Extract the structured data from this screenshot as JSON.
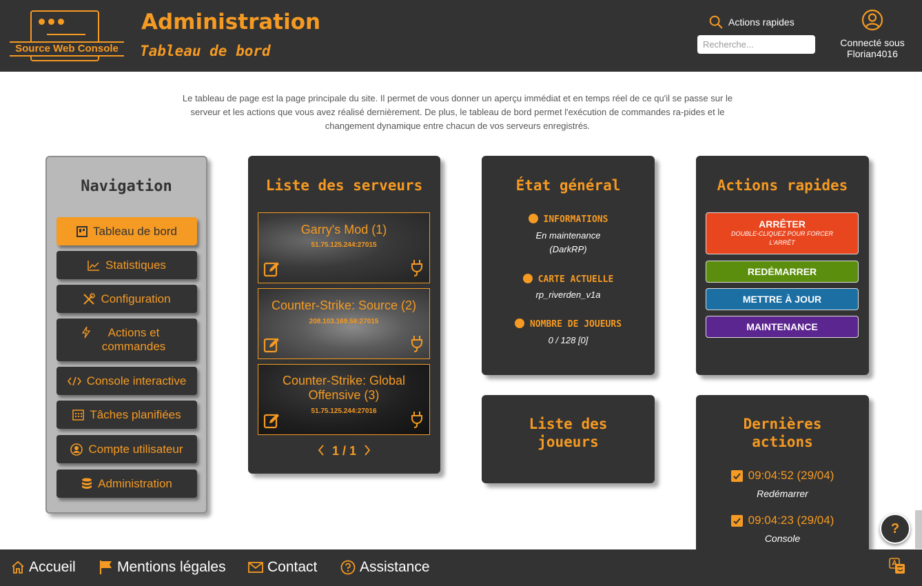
{
  "header": {
    "logo_text": "Source Web Console",
    "title": "Administration",
    "subtitle": "Tableau de bord",
    "quick_actions_label": "Actions rapides",
    "search_placeholder": "Recherche...",
    "user_line1": "Connecté sous",
    "user_line2": "Florian4016"
  },
  "intro": "Le tableau de page est la page principale du site. Il permet de vous donner un aperçu immédiat et en temps réel de ce qu'il se passe sur le serveur et les actions que vous avez réalisé dernièrement. De plus, le tableau de bord permet l'exécution de commandes ra-pides et le changement dynamique entre chacun de vos serveurs enregistrés.",
  "navigation": {
    "title": "Navigation",
    "items": [
      {
        "label": "Tableau de bord",
        "icon": "dashboard-icon",
        "active": true
      },
      {
        "label": "Statistiques",
        "icon": "chart-icon"
      },
      {
        "label": "Configuration",
        "icon": "tools-icon"
      },
      {
        "label": "Actions et commandes",
        "icon": "bolt-icon"
      },
      {
        "label": "Console interactive",
        "icon": "code-icon"
      },
      {
        "label": "Tâches planifiées",
        "icon": "calendar-icon"
      },
      {
        "label": "Compte utilisateur",
        "icon": "user-circle-icon"
      },
      {
        "label": "Administration",
        "icon": "database-icon"
      }
    ]
  },
  "servers": {
    "title": "Liste des serveurs",
    "items": [
      {
        "name": "Garry's Mod (1)",
        "address": "51.75.125.244:27015"
      },
      {
        "name": "Counter-Strike: Source (2)",
        "address": "208.103.169.58:27015"
      },
      {
        "name": "Counter-Strike: Global Offensive (3)",
        "address": "51.75.125.244:27016"
      }
    ],
    "page": "1 / 1"
  },
  "status": {
    "title": "État général",
    "info_label": "INFORMATIONS",
    "info_value_1": "En maintenance",
    "info_value_2": "(DarkRP)",
    "map_label": "CARTE ACTUELLE",
    "map_value": "rp_riverden_v1a",
    "players_label": "NOMBRE DE JOUEURS",
    "players_value": "0 / 128 [0]"
  },
  "players": {
    "title": "Liste des joueurs"
  },
  "quick_actions": {
    "title": "Actions rapides",
    "stop": "ARRÊTER",
    "stop_hint": "DOUBLE-CLIQUEZ POUR FORCER L'ARRÊT",
    "restart": "REDÉMARRER",
    "update": "METTRE À JOUR",
    "maintenance": "MAINTENANCE",
    "colors": {
      "stop": "#e8461f",
      "restart": "#5b8e0c",
      "update": "#1b6fa3",
      "maintenance": "#5c2691"
    }
  },
  "last_actions": {
    "title": "Dernières actions",
    "items": [
      {
        "time": "09:04:52 (29/04)",
        "label": "Redémarrer"
      },
      {
        "time": "09:04:23 (29/04)",
        "label": "Console"
      }
    ]
  },
  "help": "?",
  "footer": {
    "home": "Accueil",
    "legal": "Mentions légales",
    "contact": "Contact",
    "support": "Assistance"
  },
  "colors": {
    "accent": "#f59a23",
    "dark": "#333333",
    "nav_bg": "#b9b9b9"
  }
}
